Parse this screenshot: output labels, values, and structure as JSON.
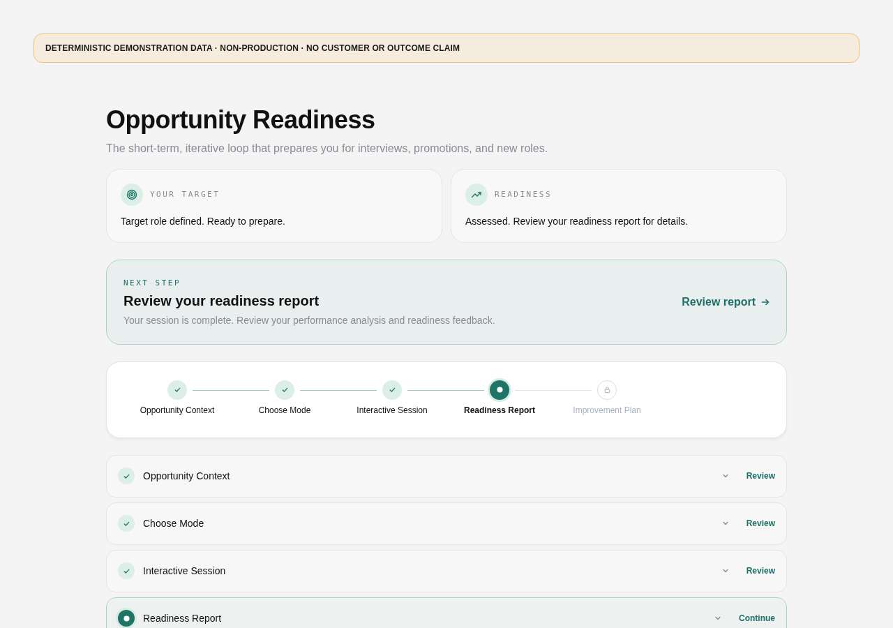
{
  "banner": "DETERMINISTIC DEMONSTRATION DATA · NON-PRODUCTION · NO CUSTOMER OR OUTCOME CLAIM",
  "title": "Opportunity Readiness",
  "subtitle": "The short-term, iterative loop that prepares you for interviews, promotions, and new roles.",
  "cards": [
    {
      "kind": "target",
      "label": "YOUR TARGET",
      "text": "Target role defined. Ready to prepare."
    },
    {
      "kind": "trend",
      "label": "READINESS",
      "text": "Assessed. Review your readiness report for details."
    }
  ],
  "next_step": {
    "label": "NEXT STEP",
    "title": "Review your readiness report",
    "description": "Your session is complete. Review your performance analysis and readiness feedback.",
    "action": "Review report"
  },
  "steps": [
    {
      "label": "Opportunity Context",
      "kind": "done"
    },
    {
      "label": "Choose Mode",
      "kind": "done"
    },
    {
      "label": "Interactive Session",
      "kind": "done"
    },
    {
      "label": "Readiness Report",
      "kind": "current"
    },
    {
      "label": "Improvement Plan",
      "kind": "locked"
    }
  ],
  "sections": [
    {
      "title": "Opportunity Context",
      "kind": "done",
      "action": "Review"
    },
    {
      "title": "Choose Mode",
      "kind": "done",
      "action": "Review"
    },
    {
      "title": "Interactive Session",
      "kind": "done",
      "action": "Review"
    },
    {
      "title": "Readiness Report",
      "kind": "current",
      "action": "Continue"
    }
  ]
}
